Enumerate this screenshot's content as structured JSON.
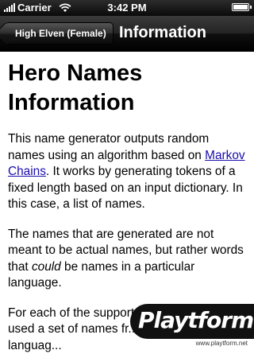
{
  "status_bar": {
    "carrier": "Carrier",
    "time": "3:42 PM"
  },
  "nav": {
    "back_label": "High Elven (Female)",
    "title": "Information"
  },
  "content": {
    "heading": "Hero Names Information",
    "p1_before": "This name generator outputs random names using an algorithm based on ",
    "p1_link": "Markov Chains",
    "p1_after": ". It works by generating tokens of a fixed length based on an input dictionary. In this case, a list of names.",
    "p2_before": "The names that are generated are not meant to be actual names, but rather words that ",
    "p2_em": "could",
    "p2_after": " be names in a particular language.",
    "p3": "For each of the supported \"languages\", I used a set of names fr... seeds for that languag..."
  },
  "watermark": {
    "logo": "Playtform",
    "url": "www.playtform.net"
  }
}
